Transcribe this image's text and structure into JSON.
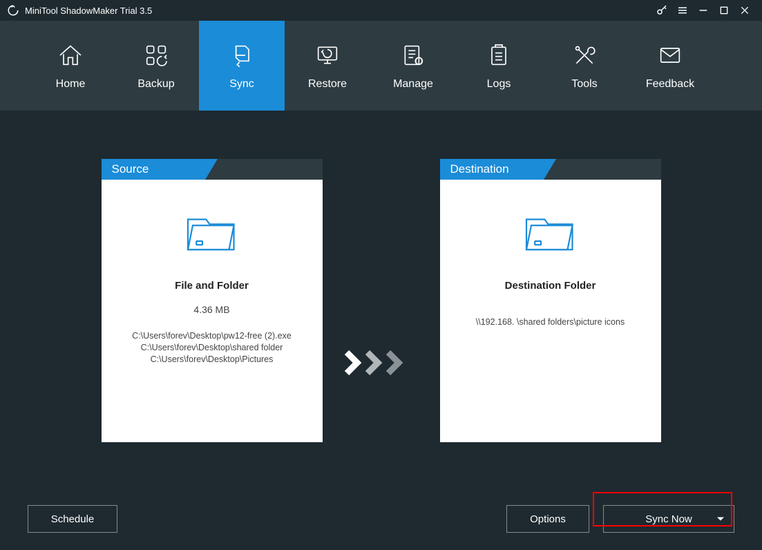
{
  "titlebar": {
    "title": "MiniTool ShadowMaker Trial 3.5"
  },
  "nav": {
    "items": [
      {
        "label": "Home"
      },
      {
        "label": "Backup"
      },
      {
        "label": "Sync"
      },
      {
        "label": "Restore"
      },
      {
        "label": "Manage"
      },
      {
        "label": "Logs"
      },
      {
        "label": "Tools"
      },
      {
        "label": "Feedback"
      }
    ]
  },
  "source": {
    "header": "Source",
    "title": "File and Folder",
    "size": "4.36 MB",
    "paths": [
      "C:\\Users\\forev\\Desktop\\pw12-free (2).exe",
      "C:\\Users\\forev\\Desktop\\shared folder",
      "C:\\Users\\forev\\Desktop\\Pictures"
    ]
  },
  "destination": {
    "header": "Destination",
    "title": "Destination Folder",
    "path": "\\\\192.168.       \\shared folders\\picture icons"
  },
  "footer": {
    "schedule": "Schedule",
    "options": "Options",
    "syncnow": "Sync Now"
  }
}
